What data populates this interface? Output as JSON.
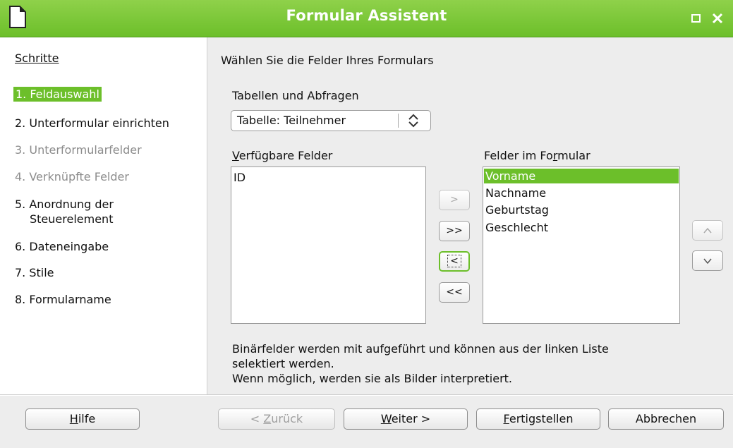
{
  "window": {
    "title": "Formular Assistent",
    "icons": {
      "app": "libreoffice-doc-icon",
      "maximize": "maximize-icon",
      "close": "close-icon"
    },
    "accent_color": "#6cbf2a"
  },
  "sidebar": {
    "heading": "Schritte",
    "steps": [
      {
        "label": "1. Feldauswahl",
        "state": "active"
      },
      {
        "label": "2. Unterformular einrichten",
        "state": "enabled"
      },
      {
        "label": "3. Unterformularfelder",
        "state": "disabled"
      },
      {
        "label": "4. Verknüpfte Felder",
        "state": "disabled"
      },
      {
        "label": "5. Anordnung der",
        "label2": "Steuerelement",
        "state": "enabled"
      },
      {
        "label": "6. Dateneingabe",
        "state": "enabled"
      },
      {
        "label": "7. Stile",
        "state": "enabled"
      },
      {
        "label": "8. Formularname",
        "state": "enabled"
      }
    ]
  },
  "main": {
    "heading": "Wählen Sie die Felder Ihres Formulars",
    "tables_label": "Tabellen und Abfragen",
    "table_select": {
      "value": "Tabelle: Teilnehmer",
      "icon": "updown-chevron-icon"
    },
    "available": {
      "label_key": "V",
      "label_rest": "erfügbare Felder",
      "items": [
        "ID"
      ]
    },
    "selected": {
      "label_pre": "Felder im Fo",
      "label_key": "r",
      "label_post": "mular",
      "items": [
        "Vorname",
        "Nachname",
        "Geburtstag",
        "Geschlecht"
      ],
      "selected_index": 0
    },
    "move_buttons": {
      "add": ">",
      "add_all": ">>",
      "remove": "<",
      "remove_all": "<<"
    },
    "order_buttons": {
      "up": "^",
      "down": "v"
    },
    "info_line1": "Binärfelder werden mit aufgeführt und können aus der linken Liste",
    "info_line2": "selektiert werden.",
    "info_line3": "Wenn möglich, werden sie als Bilder interpretiert."
  },
  "footer": {
    "help": {
      "key": "H",
      "rest": "ilfe"
    },
    "back": {
      "pre": "< ",
      "key": "Z",
      "rest": "urück"
    },
    "next": {
      "key": "W",
      "rest": "eiter >"
    },
    "finish": {
      "key": "F",
      "rest": "ertigstellen"
    },
    "cancel": "Abbrechen"
  }
}
